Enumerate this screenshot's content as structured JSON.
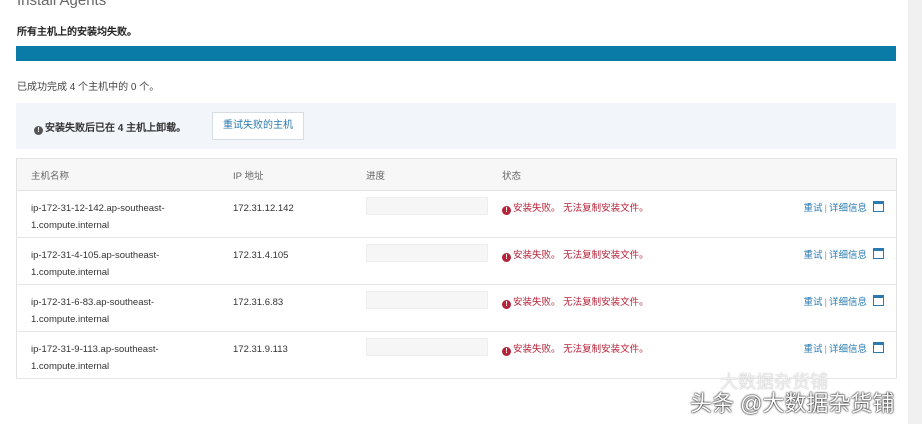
{
  "title": "Install Agents",
  "subtitle": "所有主机上的安装均失败。",
  "progress_percent": 100,
  "done_text": "已成功完成 4 个主机中的 0 个。",
  "info": {
    "message": "安装失败后已在 4 主机上卸载。",
    "retry_failed_label": "重试失败的主机"
  },
  "table": {
    "headers": [
      "主机名称",
      "IP 地址",
      "进度",
      "状态"
    ],
    "rows": [
      {
        "host_line1": "ip-172-31-12-142.ap-southeast-",
        "host_line2": "1.compute.internal",
        "ip": "172.31.12.142",
        "status": "安装失败。 无法复制安装文件。",
        "retry": "重试",
        "details": "详细信息"
      },
      {
        "host_line1": "ip-172-31-4-105.ap-southeast-",
        "host_line2": "1.compute.internal",
        "ip": "172.31.4.105",
        "status": "安装失败。 无法复制安装文件。",
        "retry": "重试",
        "details": "详细信息"
      },
      {
        "host_line1": "ip-172-31-6-83.ap-southeast-",
        "host_line2": "1.compute.internal",
        "ip": "172.31.6.83",
        "status": "安装失败。 无法复制安装文件。",
        "retry": "重试",
        "details": "详细信息"
      },
      {
        "host_line1": "ip-172-31-9-113.ap-southeast-",
        "host_line2": "1.compute.internal",
        "ip": "172.31.9.113",
        "status": "安装失败。 无法复制安装文件。",
        "retry": "重试",
        "details": "详细信息"
      }
    ]
  },
  "watermark": "头条 @大数据杂货铺",
  "watermark2": "大数据杂货铺"
}
